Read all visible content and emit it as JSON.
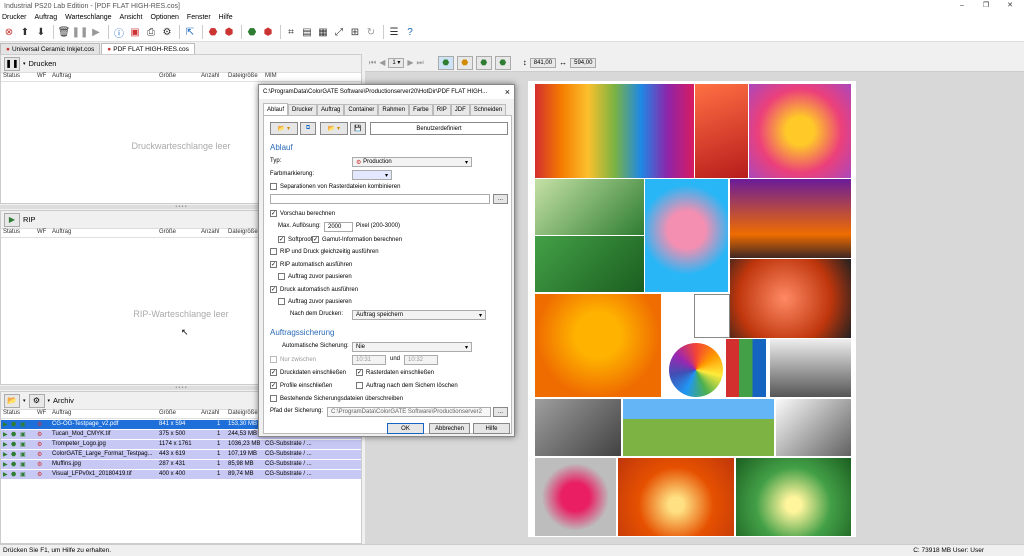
{
  "window": {
    "title": "Industrial PS20 Lab Edition - [PDF FLAT HIGH-RES.cos]"
  },
  "menu": [
    "Drucker",
    "Auftrag",
    "Warteschlange",
    "Ansicht",
    "Optionen",
    "Fenster",
    "Hilfe"
  ],
  "doc_tabs": [
    "Universal Ceramic Inkjet.cos",
    "PDF FLAT HIGH-RES.cos"
  ],
  "columns": {
    "status": "Status",
    "wf": "WF",
    "auftrag": "Auftrag",
    "groesse": "Größe",
    "anzahl": "Anzahl",
    "dateigroesse": "Dateigröße",
    "mim": "MIM"
  },
  "print_panel": {
    "title": "Drucken",
    "empty": "Druckwarteschlange leer"
  },
  "rip_panel": {
    "title": "RIP",
    "empty": "RIP-Warteschlange leer"
  },
  "archive_panel": {
    "title": "Archiv",
    "rows": [
      {
        "name": "CG-OG-Testpage_v2.pdf",
        "size": "841 x 594",
        "count": "1",
        "file": "153,30 MB",
        "mim": "CG-Substrate / ..."
      },
      {
        "name": "Tucan_Mod_CMYK.tif",
        "size": "375 x 500",
        "count": "1",
        "file": "244,53 MB",
        "mim": "CG-Substrate / ..."
      },
      {
        "name": "Trompeter_Logo.jpg",
        "size": "1174 x 1761",
        "count": "1",
        "file": "1036,23 MB",
        "mim": "CG-Substrate / ..."
      },
      {
        "name": "ColorGATE_Large_Format_Testpag...",
        "size": "443 x 619",
        "count": "1",
        "file": "107,19 MB",
        "mim": "CG-Substrate / ..."
      },
      {
        "name": "Muffins.jpg",
        "size": "287 x 431",
        "count": "1",
        "file": "85,98 MB",
        "mim": "CG-Substrate / ..."
      },
      {
        "name": "Visual_LFPv0x1_20180419.tif",
        "size": "400 x 400",
        "count": "1",
        "file": "89,74 MB",
        "mim": "CG-Substrate / ..."
      }
    ]
  },
  "preview": {
    "page": "1",
    "width": "841,00",
    "height": "594,00"
  },
  "dialog": {
    "title": "C:\\ProgramData\\ColorGATE Software\\Productionserver20\\HotDir\\PDF FLAT HIGH...",
    "close": "×",
    "tabs": [
      "Ablauf",
      "Drucker",
      "Auftrag",
      "Container",
      "Rahmen",
      "Farbe",
      "RIP",
      "JDF",
      "Schneiden"
    ],
    "preset": "Benutzerdefiniert",
    "sec_ablauf": "Ablauf",
    "typ_label": "Typ:",
    "typ_value": "Production",
    "farb_label": "Farbmarkierung:",
    "sep_label": "Separationen von Rasterdateien kombinieren",
    "vorschau_label": "Vorschau berechnen",
    "max_label": "Max. Auflösung:",
    "max_value": "2000",
    "max_unit": "Pixel (200-3000)",
    "softproof": "Softproof",
    "gamut": "Gamut-Information berechnen",
    "ripdruck": "RIP und Druck gleichzeitig ausführen",
    "ripauto": "RIP automatisch ausführen",
    "pause1": "Auftrag zuvor pausieren",
    "druckauto": "Druck automatisch ausführen",
    "pause2": "Auftrag zuvor pausieren",
    "nach_label": "Nach dem Drucken:",
    "nach_value": "Auftrag speichern",
    "sec_sicherung": "Auftragssicherung",
    "auto_label": "Automatische Sicherung:",
    "auto_value": "Nie",
    "nur_label": "Nur zwischen",
    "t1": "10:31",
    "und": "und",
    "t2": "10:32",
    "druckdaten": "Druckdaten einschließen",
    "raster": "Rasterdaten einschließen",
    "profile": "Profile einschließen",
    "loeschen": "Auftrag nach dem Sichern löschen",
    "ueber": "Bestehende Sicherungsdateien überschreiben",
    "pfad_label": "Pfad der Sicherung:",
    "pfad_value": "C:\\ProgramData\\ColorGATE Software\\Productionserver2",
    "browse": "...",
    "ok": "OK",
    "abbrechen": "Abbrechen",
    "hilfe": "Hilfe"
  },
  "status": {
    "left": "Drücken Sie F1, um Hilfe zu erhalten.",
    "right": "C: 73918 MB User: User"
  },
  "colors": {
    "selection": "#1e6fd9",
    "archive_row": "#c8c8f5",
    "section": "#2a6ab8"
  }
}
